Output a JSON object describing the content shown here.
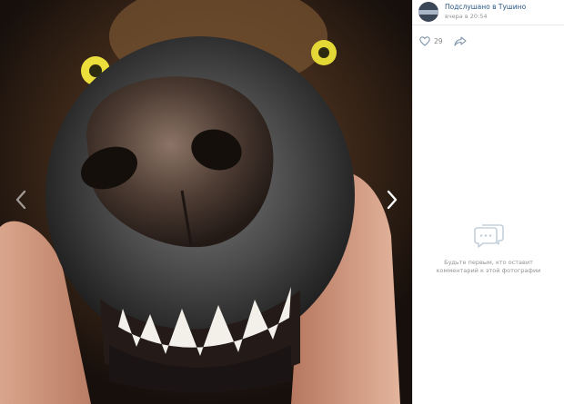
{
  "photo": {
    "alt": ""
  },
  "navigation": {
    "prev_icon": "chevron-left-icon",
    "next_icon": "chevron-right-icon"
  },
  "post": {
    "group_name": "Подслушано в Тушино",
    "time": "вчера в 20:54",
    "likes": "29"
  },
  "comments": {
    "empty_line1": "Будьте первым, кто оставит",
    "empty_line2": "комментарий к этой фотографии"
  },
  "colors": {
    "link": "#2a5885",
    "muted": "#939393",
    "panel_bg": "#ffffff",
    "border": "#e7e8ec"
  }
}
